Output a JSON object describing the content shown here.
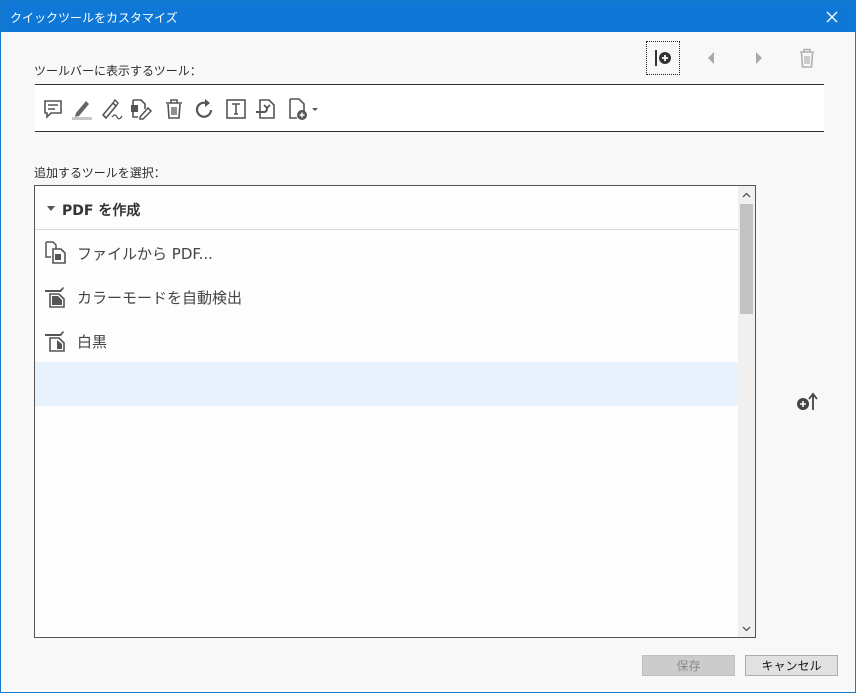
{
  "window": {
    "title": "クイックツールをカスタマイズ"
  },
  "toolbar_section": {
    "label": "ツールバーに表示するツール：",
    "tools": [
      "comment-icon",
      "highlight-icon",
      "sign-pen-icon",
      "edit-pdf-icon",
      "delete-icon",
      "rotate-icon",
      "text-box-icon",
      "export-icon",
      "create-pdf-dropdown-icon"
    ]
  },
  "top_controls": [
    "add-separator-icon",
    "move-left-icon",
    "move-right-icon",
    "trash-icon"
  ],
  "select_section": {
    "label": "追加するツールを選択：",
    "group": "PDF を作成",
    "items": [
      {
        "label": "ファイルから PDF...",
        "icon": "file-to-pdf-icon"
      },
      {
        "label": "カラーモードを自動検出",
        "icon": "scan-color-icon"
      },
      {
        "label": "白黒",
        "icon": "scan-bw-icon"
      }
    ]
  },
  "buttons": {
    "save": "保存",
    "cancel": "キャンセル"
  }
}
